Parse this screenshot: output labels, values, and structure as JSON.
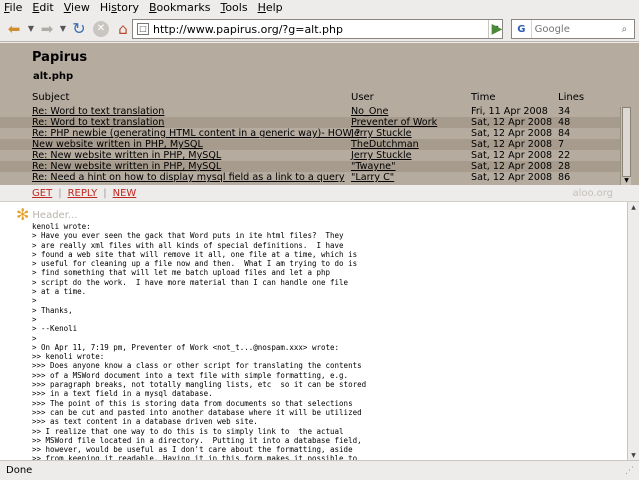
{
  "menu": [
    {
      "first": "F",
      "rest": "ile"
    },
    {
      "first": "E",
      "rest": "dit"
    },
    {
      "first": "V",
      "rest": "iew"
    },
    {
      "first": "",
      "rest": "Hi",
      "u": "s",
      "rest2": "tory"
    },
    {
      "first": "B",
      "rest": "ookmarks"
    },
    {
      "first": "T",
      "rest": "ools"
    },
    {
      "first": "H",
      "rest": "elp"
    }
  ],
  "toolbar": {
    "url": "http://www.papirus.org/?g=alt.php",
    "search_placeholder": "Google",
    "search_engine_letter": "G"
  },
  "app": {
    "title": "Papirus",
    "group": "alt.php"
  },
  "columns": {
    "subject": "Subject",
    "user": "User",
    "time": "Time",
    "lines": "Lines"
  },
  "threads": [
    {
      "subject": "Re: Word to text translation",
      "user": "No_One",
      "time": "Fri, 11 Apr 2008",
      "lines": "34"
    },
    {
      "subject": "Re: Word to text translation",
      "user": "Preventer of Work",
      "time": "Sat, 12 Apr 2008",
      "lines": "48"
    },
    {
      "subject": "Re: PHP newbie (generating HTML content in a generic way)- HOW ?",
      "user": "Jerry Stuckle",
      "time": "Sat, 12 Apr 2008",
      "lines": "84"
    },
    {
      "subject": "New website written in PHP, MySQL",
      "user": "TheDutchman",
      "time": "Sat, 12 Apr 2008",
      "lines": "7"
    },
    {
      "subject": "Re: New website written in PHP, MySQL",
      "user": "Jerry Stuckle",
      "time": "Sat, 12 Apr 2008",
      "lines": "22"
    },
    {
      "subject": "Re: New website written in PHP, MySQL",
      "user": "\"Twayne\"",
      "time": "Sat, 12 Apr 2008",
      "lines": "28"
    },
    {
      "subject": "Re: Need a hint on how to display mysql field as a link to a query",
      "user": "\"Larry C\"",
      "time": "Sat, 12 Apr 2008",
      "lines": "86"
    }
  ],
  "actions": {
    "get": "GET",
    "reply": "REPLY",
    "new": "NEW",
    "sep": "|"
  },
  "brand": "aloo.org",
  "message": {
    "header_toggle": "Header...",
    "body": "kenoli wrote:\n> Have you ever seen the gack that Word puts in ite html files?  They\n> are really xml files with all kinds of special definitions.  I have\n> found a web site that will remove it all, one file at a time, which is\n> useful for cleaning up a file now and then.  What I am trying to do is\n> find something that will let me batch upload files and let a php\n> script do the work.  I have more material than I can handle one file\n> at a time.\n>\n> Thanks,\n>\n> --Kenoli\n>\n> On Apr 11, 7:19 pm, Preventer of Work <not_t...@nospam.xxx> wrote:\n>> kenoli wrote:\n>>> Does anyone know a class or other script for translating the contents\n>>> of a MSWord document into a text file with simple formatting, e.g.\n>>> paragraph breaks, not totally mangling lists, etc  so it can be stored\n>>> in a text field in a mysql database.\n>>> The point of this is storing data from documents so that selections\n>>> can be cut and pasted into another database where it will be utilized\n>>> as text content in a database driven web site.\n>> I realize that one way to do this is to simply link to  the actual\n>> MSWord file located in a directory.  Putting it into a database field,\n>> however, would be useful as I don't care about the formatting, aside\n>> from keeping it readable. Having it in this form makes it possible to\n>> easily copy and paste stuff from  fields in the one database to fields"
  },
  "status": "Done"
}
